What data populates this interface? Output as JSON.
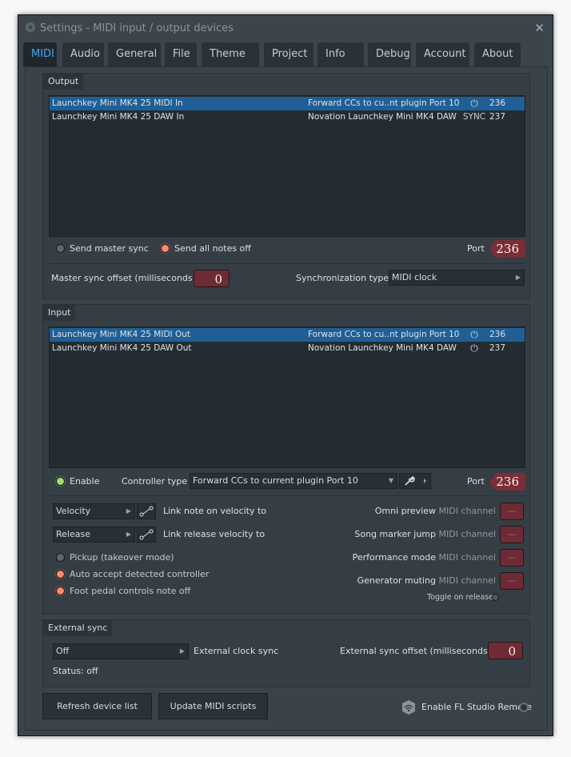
{
  "window": {
    "title": "Settings - MIDI input / output devices",
    "close_glyph": "✕"
  },
  "tabs": [
    "MIDI",
    "Audio",
    "General",
    "File",
    "Theme",
    "Project",
    "Info",
    "Debug",
    "Account",
    "About"
  ],
  "output": {
    "header": "Output",
    "devices": [
      {
        "name": "Launchkey Mini MK4 25 MIDI In",
        "script": "Forward CCs to cu..nt plugin Port 10",
        "status_icon": "power-icon",
        "port": "236",
        "selected": true
      },
      {
        "name": "Launchkey Mini MK4 25 DAW In",
        "script": "Novation Launchkey Mini MK4 DAW",
        "status": "SYNC",
        "port": "237",
        "selected": false
      }
    ],
    "send_master_sync": "Send master sync",
    "send_all_notes_off": "Send all notes off",
    "port_label": "Port",
    "port_value": "236",
    "master_sync_offset_label": "Master sync offset (milliseconds)",
    "master_sync_offset_value": "0",
    "sync_type_label": "Synchronization type",
    "sync_type_value": "MIDI clock"
  },
  "input": {
    "header": "Input",
    "devices": [
      {
        "name": "Launchkey Mini MK4 25 MIDI Out",
        "script": "Forward CCs to cu..nt plugin Port 10",
        "status_icon": "power-icon",
        "port": "236",
        "selected": true
      },
      {
        "name": "Launchkey Mini MK4 25 DAW Out",
        "script": "Novation Launchkey Mini MK4 DAW",
        "status_icon": "power-icon",
        "port": "237",
        "selected": false
      }
    ],
    "enable_label": "Enable",
    "controller_type_label": "Controller type",
    "controller_type_value": "Forward CCs to current plugin Port 10",
    "port_label": "Port",
    "port_value": "236",
    "velocity_select": "Velocity",
    "link_note_velocity": "Link note on velocity to",
    "release_select": "Release",
    "link_release_velocity": "Link release velocity to",
    "pickup": "Pickup (takeover mode)",
    "auto_accept": "Auto accept detected controller",
    "foot_pedal": "Foot pedal controls note off",
    "channels": [
      {
        "label": "Omni preview",
        "suffix": "MIDI channel",
        "value": "---"
      },
      {
        "label": "Song marker jump",
        "suffix": "MIDI channel",
        "value": "---"
      },
      {
        "label": "Performance mode",
        "suffix": "MIDI channel",
        "value": "---"
      },
      {
        "label": "Generator muting",
        "suffix": "MIDI channel",
        "value": "---"
      }
    ],
    "toggle_on_release": "Toggle on release"
  },
  "external_sync": {
    "header": "External sync",
    "clock_value": "Off",
    "clock_label": "External clock sync",
    "offset_label": "External sync offset (milliseconds)",
    "offset_value": "0",
    "status": "Status: off"
  },
  "footer": {
    "refresh": "Refresh device list",
    "update_scripts": "Update MIDI scripts",
    "remote_label": "Enable FL Studio Remote"
  },
  "colors": {
    "accent": "#4aa6ee",
    "selected_row": "#1f5f96",
    "power_on": "#a6e05c",
    "number_box": "#7a2e3a"
  }
}
